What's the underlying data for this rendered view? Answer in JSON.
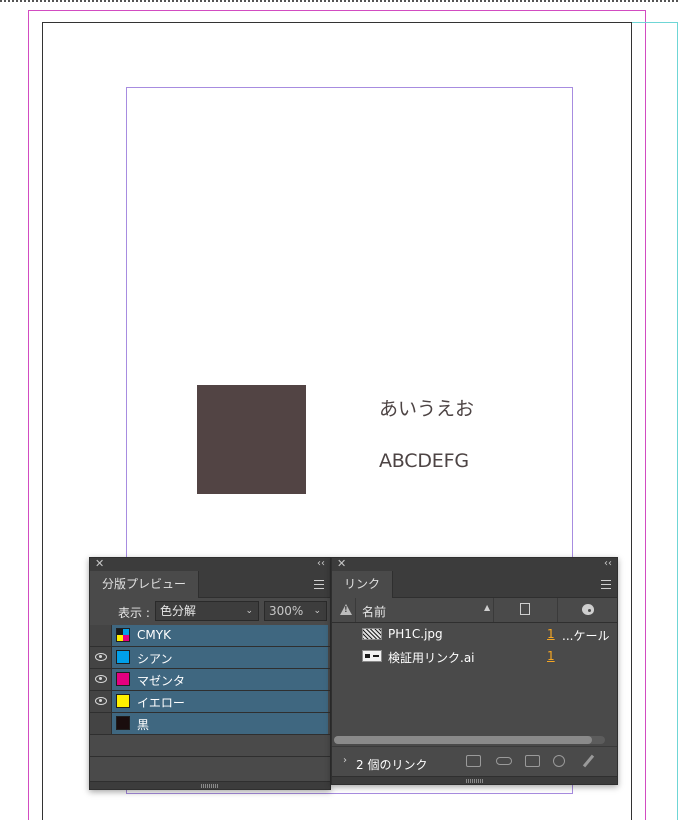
{
  "document": {
    "sample_text_jp": "あいうえお",
    "sample_text_en": "ABCDEFG",
    "swatch_color": "#524444"
  },
  "separations_panel": {
    "tab_label": "分版プレビュー",
    "display_label": "表示 :",
    "mode_value": "色分解",
    "zoom_value": "300%",
    "rows": [
      {
        "name": "CMYK",
        "visible": false,
        "chip": "cmyk"
      },
      {
        "name": "シアン",
        "visible": true,
        "chip": "#00a0e9"
      },
      {
        "name": "マゼンタ",
        "visible": true,
        "chip": "#e4007f"
      },
      {
        "name": "イエロー",
        "visible": true,
        "chip": "#fff100"
      },
      {
        "name": "黒",
        "visible": false,
        "chip": "#1a0d0d"
      }
    ]
  },
  "links_panel": {
    "tab_label": "リンク",
    "column_name": "名前",
    "items": [
      {
        "name": "PH1C.jpg",
        "page": "1",
        "scale": "...ケール",
        "type": "jpg"
      },
      {
        "name": "検証用リンク.ai",
        "page": "1",
        "scale": "",
        "type": "ai"
      }
    ],
    "footer_count": "2 個のリンク"
  },
  "colors": {
    "panel_bg": "#4a4a4a",
    "selected_row": "#3f6780",
    "page_number_link": "#f5a623",
    "bleed_guide": "#d24cc1",
    "margin_guide": "#a78ce0",
    "slug_guide": "#6fd6d6"
  }
}
